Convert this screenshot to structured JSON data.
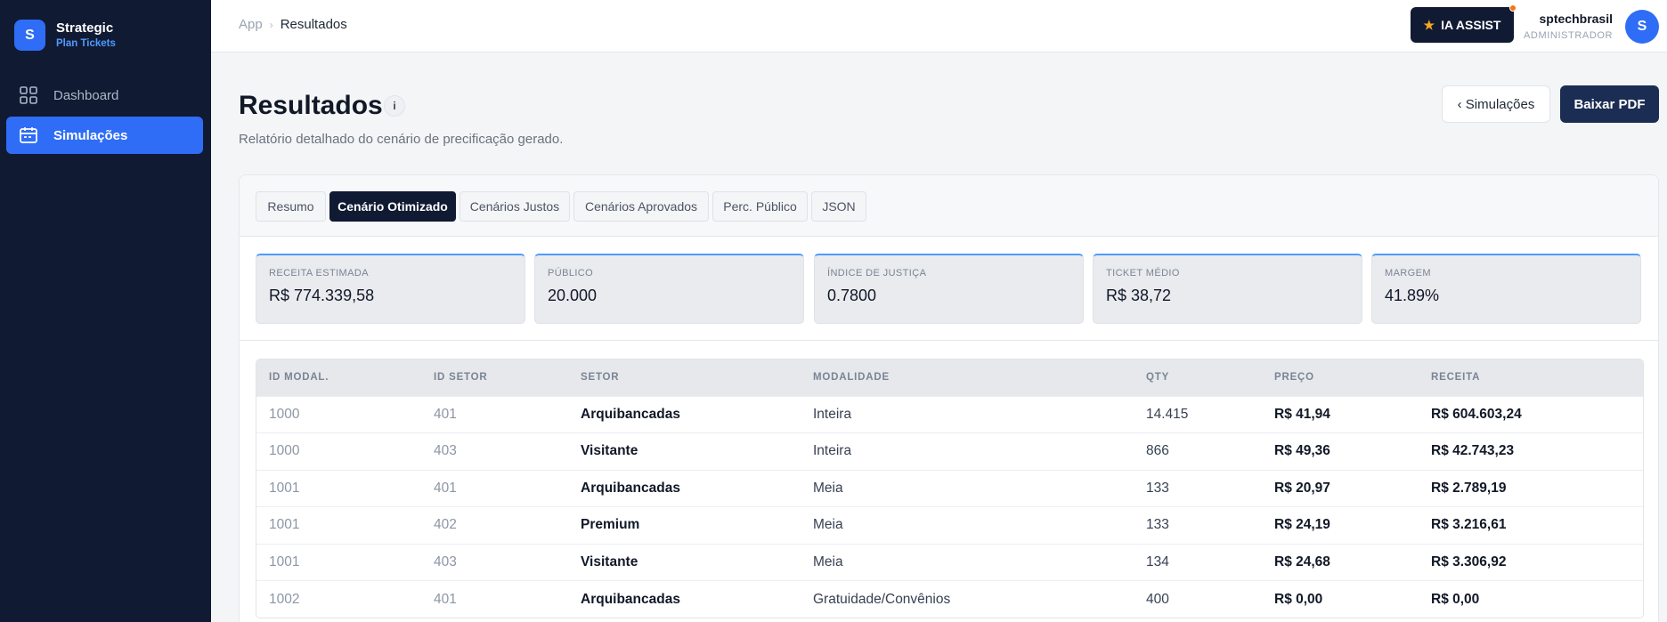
{
  "sidebar": {
    "brand_initial": "S",
    "brand_name": "Strategic",
    "brand_sub": "Plan Tickets",
    "items": [
      {
        "label": "Dashboard",
        "icon": "grid-icon",
        "active": false
      },
      {
        "label": "Simulações",
        "icon": "calendar-icon",
        "active": true
      }
    ]
  },
  "topbar": {
    "breadcrumb_root": "App",
    "breadcrumb_sep": "›",
    "breadcrumb_current": "Resultados",
    "ia_button": "IA ASSIST",
    "user_name": "sptechbrasil",
    "user_role": "ADMINISTRADOR",
    "avatar_initial": "S"
  },
  "header": {
    "title": "Resultados",
    "info_label": "i",
    "subtitle": "Relatório detalhado do cenário de precificação gerado.",
    "back_button": "‹ Simulações",
    "pdf_button": "Baixar PDF"
  },
  "tabs": [
    {
      "label": "Resumo",
      "active": false
    },
    {
      "label": "Cenário Otimizado",
      "active": true
    },
    {
      "label": "Cenários Justos",
      "active": false
    },
    {
      "label": "Cenários Aprovados",
      "active": false
    },
    {
      "label": "Perc. Público",
      "active": false
    },
    {
      "label": "JSON",
      "active": false
    }
  ],
  "metrics": [
    {
      "label": "RECEITA ESTIMADA",
      "value": "R$ 774.339,58"
    },
    {
      "label": "PÚBLICO",
      "value": "20.000"
    },
    {
      "label": "ÍNDICE DE JUSTIÇA",
      "value": "0.7800"
    },
    {
      "label": "TICKET MÉDIO",
      "value": "R$ 38,72"
    },
    {
      "label": "MARGEM",
      "value": "41.89%"
    }
  ],
  "table": {
    "headers": [
      "ID MODAL.",
      "ID SETOR",
      "SETOR",
      "MODALIDADE",
      "QTY",
      "PREÇO",
      "RECEITA"
    ],
    "rows": [
      [
        "1000",
        "401",
        "Arquibancadas",
        "Inteira",
        "14.415",
        "R$ 41,94",
        "R$ 604.603,24"
      ],
      [
        "1000",
        "403",
        "Visitante",
        "Inteira",
        "866",
        "R$ 49,36",
        "R$ 42.743,23"
      ],
      [
        "1001",
        "401",
        "Arquibancadas",
        "Meia",
        "133",
        "R$ 20,97",
        "R$ 2.789,19"
      ],
      [
        "1001",
        "402",
        "Premium",
        "Meia",
        "133",
        "R$ 24,19",
        "R$ 3.216,61"
      ],
      [
        "1001",
        "403",
        "Visitante",
        "Meia",
        "134",
        "R$ 24,68",
        "R$ 3.306,92"
      ],
      [
        "1002",
        "401",
        "Arquibancadas",
        "Gratuidade/Convênios",
        "400",
        "R$ 0,00",
        "R$ 0,00"
      ]
    ]
  },
  "colors": {
    "sidebar_bg": "#111a33",
    "accent": "#2f6df6",
    "metric_top_border": "#4e9bff",
    "pdf_button_bg": "#1b2d52"
  }
}
